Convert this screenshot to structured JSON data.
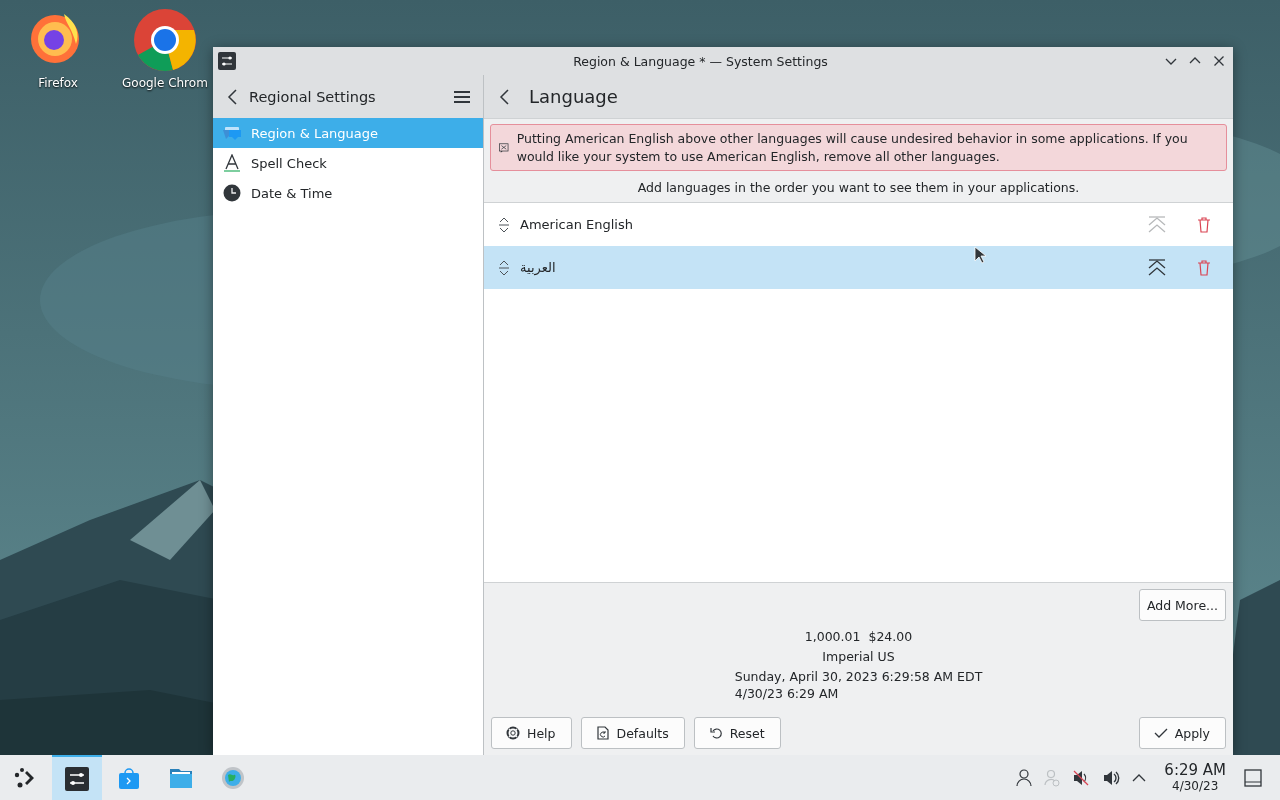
{
  "desktop_icons": [
    {
      "label": "Firefox",
      "kind": "firefox"
    },
    {
      "label": "Google Chrom",
      "kind": "chrome"
    }
  ],
  "window": {
    "title": "Region & Language * — System Settings"
  },
  "sidebar": {
    "title": "Regional Settings",
    "items": [
      {
        "label": "Region & Language",
        "kind": "region",
        "selected": true
      },
      {
        "label": "Spell Check",
        "kind": "spell",
        "selected": false
      },
      {
        "label": "Date & Time",
        "kind": "clock",
        "selected": false
      }
    ]
  },
  "page": {
    "title": "Language",
    "warning": "Putting American English above other languages will cause undesired behavior in some applications. If you would like your system to use American English, remove all other languages.",
    "hint": "Add languages in the order you want to see them in your applications.",
    "languages": [
      {
        "name": "American English",
        "selected": false,
        "disabled": true
      },
      {
        "name": "العربية",
        "selected": true,
        "disabled": false
      }
    ],
    "add_button": "Add More...",
    "preview": {
      "number": "1,000.01",
      "currency": "$24.00",
      "measurement": "Imperial US",
      "time_long": "Sunday, April 30, 2023 6:29:58 AM EDT",
      "time_short": "4/30/23 6:29 AM"
    }
  },
  "buttons": [
    {
      "label": "Help",
      "kind": "help"
    },
    {
      "label": "Defaults",
      "kind": "defaults"
    },
    {
      "label": "Reset",
      "kind": "reset"
    },
    {
      "label": "Apply",
      "kind": "apply"
    }
  ],
  "taskbar": {
    "apps": [
      {
        "kind": "launcher",
        "selected": false
      },
      {
        "kind": "settings",
        "selected": true
      },
      {
        "kind": "store",
        "selected": false
      },
      {
        "kind": "files",
        "selected": false
      },
      {
        "kind": "globe",
        "selected": false
      }
    ],
    "clock": {
      "time": "6:29 AM",
      "date": "4/30/23"
    }
  }
}
